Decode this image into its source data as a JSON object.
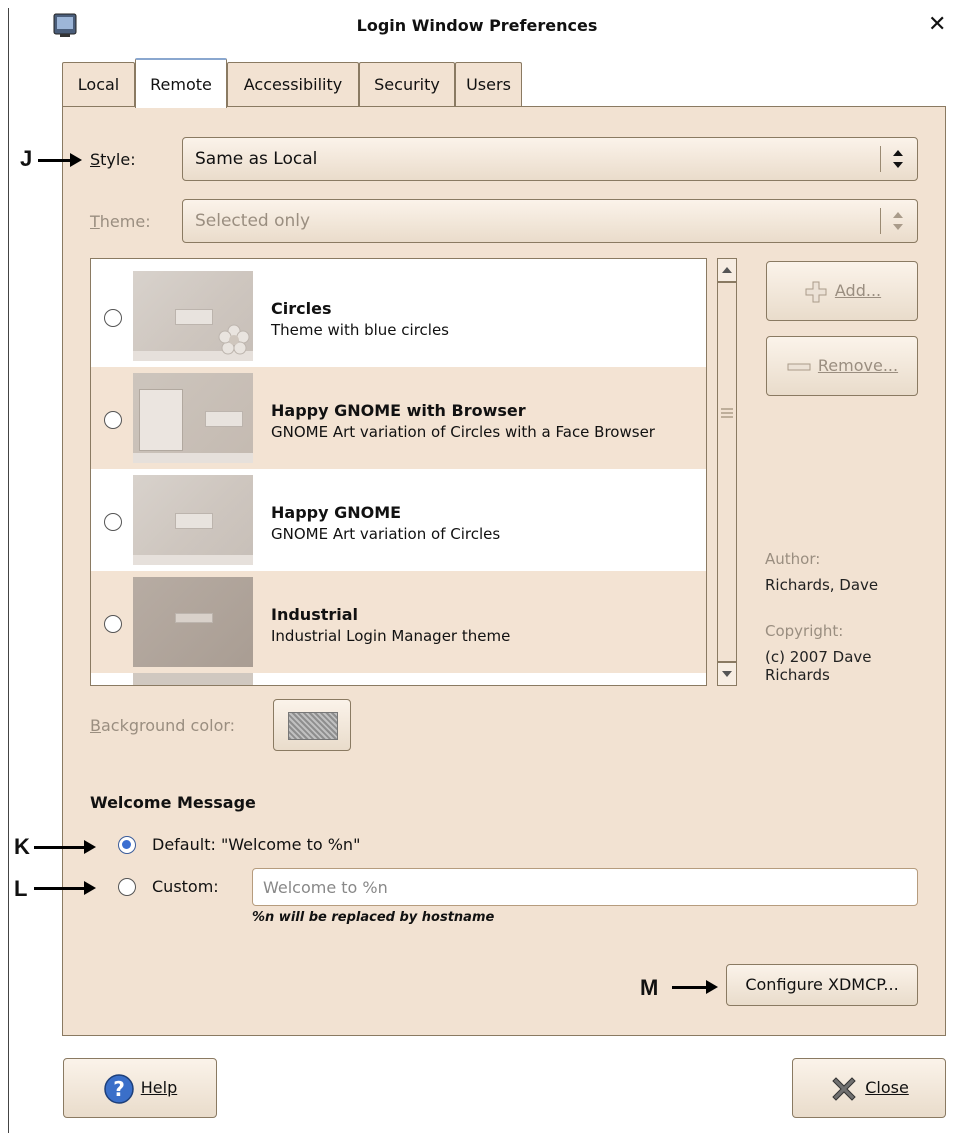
{
  "window": {
    "title": "Login Window Preferences",
    "close_icon": "close-icon"
  },
  "tabs": [
    {
      "label": "Local"
    },
    {
      "label": "Remote"
    },
    {
      "label": "Accessibility"
    },
    {
      "label": "Security"
    },
    {
      "label": "Users"
    }
  ],
  "active_tab": "Remote",
  "style": {
    "label": "Style:",
    "value": "Same as Local"
  },
  "theme": {
    "label": "Theme:",
    "value": "Selected only"
  },
  "themes": [
    {
      "name": "Circles",
      "description": "Theme with blue circles"
    },
    {
      "name": "Happy GNOME with Browser",
      "description": "GNOME Art variation of Circles with a Face Browser"
    },
    {
      "name": "Happy GNOME",
      "description": "GNOME Art variation of Circles"
    },
    {
      "name": "Industrial",
      "description": "Industrial Login Manager theme"
    }
  ],
  "side_buttons": {
    "add": "Add...",
    "remove": "Remove..."
  },
  "theme_info": {
    "author_label": "Author:",
    "author": "Richards, Dave",
    "copyright_label": "Copyright:",
    "copyright": "(c) 2007 Dave Richards"
  },
  "background_color": {
    "label": "Background color:"
  },
  "welcome": {
    "heading": "Welcome Message",
    "default_label": "Default: \"Welcome to %n\"",
    "custom_label": "Custom:",
    "custom_value": "Welcome to %n",
    "hint": "%n will be replaced by hostname"
  },
  "configure_button": "Configure XDMCP...",
  "footer": {
    "help": "Help",
    "close": "Close"
  },
  "annotations": {
    "j": "J",
    "k": "K",
    "l": "L",
    "m": "M"
  },
  "colors": {
    "panel_bg": "#f2e2d2",
    "border": "#8a7a62",
    "selection_accent": "#3b6fd1"
  }
}
